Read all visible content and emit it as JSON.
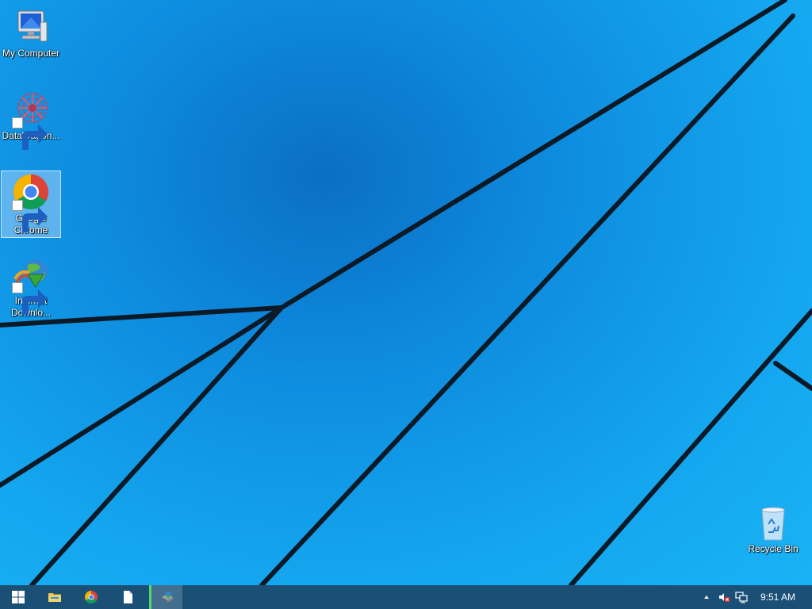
{
  "desktop": {
    "icons": [
      {
        "label": "My Computer",
        "icon": "my-computer-icon"
      },
      {
        "label": "DataWagon...",
        "icon": "datawagon-icon"
      },
      {
        "label": "Google Chrome",
        "icon": "google-chrome-icon"
      },
      {
        "label": "Internet Downlo...",
        "icon": "internet-download-manager-icon"
      },
      {
        "label": "Recycle Bin",
        "icon": "recycle-bin-icon"
      }
    ]
  },
  "taskbar": {
    "buttons": [
      {
        "name": "start",
        "icon": "windows-logo-icon"
      },
      {
        "name": "file-explorer",
        "icon": "folder-icon"
      },
      {
        "name": "chrome",
        "icon": "chrome-icon"
      },
      {
        "name": "document",
        "icon": "document-icon"
      },
      {
        "name": "idm",
        "icon": "download-manager-icon",
        "active": true
      }
    ],
    "tray": {
      "icons": [
        "show-hidden-icons-chevron",
        "speaker-muted-icon",
        "network-icon"
      ],
      "clock": "9:51 AM"
    }
  },
  "colors": {
    "wallpaper": "#0e8ddf",
    "taskbar": "#1a4f76",
    "active_indicator": "#4cd964"
  }
}
